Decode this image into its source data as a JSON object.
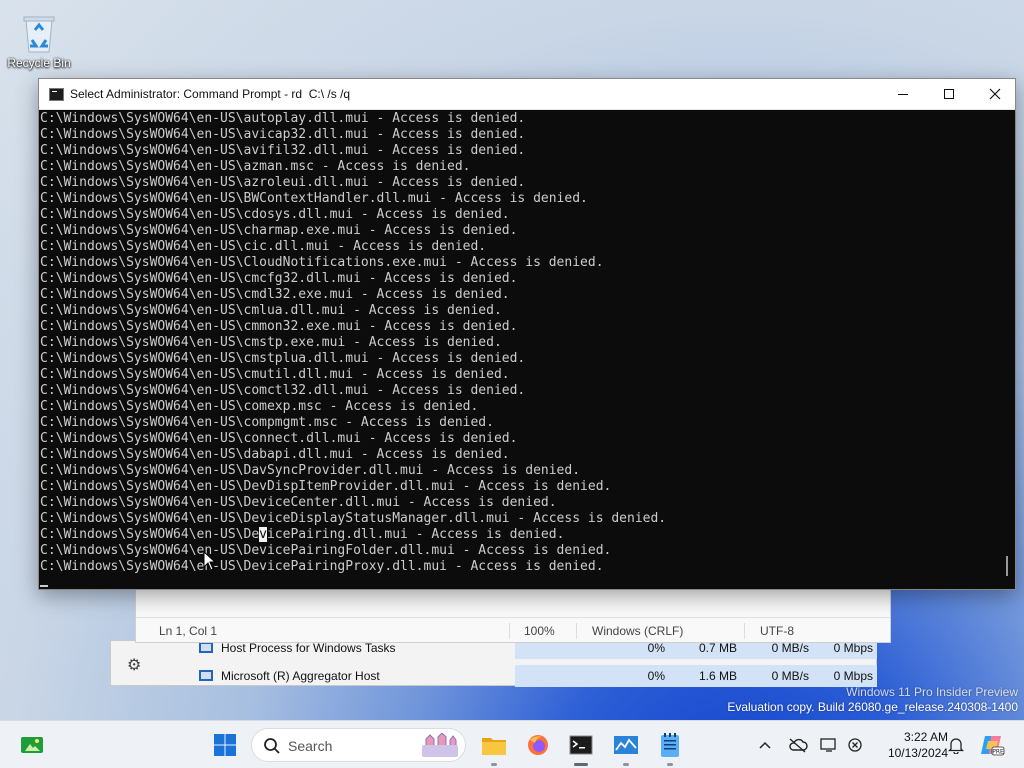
{
  "desktop": {
    "recycle_bin_label": "Recycle Bin",
    "watermark_line1": "Windows 11 Pro Insider Preview",
    "watermark_line2": "Evaluation copy. Build 26080.ge_release.240308-1400"
  },
  "cmd_window": {
    "title": "Select Administrator: Command Prompt - rd  C:\\ /s /q",
    "lines": [
      "C:\\Windows\\SysWOW64\\en-US\\autoplay.dll.mui - Access is denied.",
      "C:\\Windows\\SysWOW64\\en-US\\avicap32.dll.mui - Access is denied.",
      "C:\\Windows\\SysWOW64\\en-US\\avifil32.dll.mui - Access is denied.",
      "C:\\Windows\\SysWOW64\\en-US\\azman.msc - Access is denied.",
      "C:\\Windows\\SysWOW64\\en-US\\azroleui.dll.mui - Access is denied.",
      "C:\\Windows\\SysWOW64\\en-US\\BWContextHandler.dll.mui - Access is denied.",
      "C:\\Windows\\SysWOW64\\en-US\\cdosys.dll.mui - Access is denied.",
      "C:\\Windows\\SysWOW64\\en-US\\charmap.exe.mui - Access is denied.",
      "C:\\Windows\\SysWOW64\\en-US\\cic.dll.mui - Access is denied.",
      "C:\\Windows\\SysWOW64\\en-US\\CloudNotifications.exe.mui - Access is denied.",
      "C:\\Windows\\SysWOW64\\en-US\\cmcfg32.dll.mui - Access is denied.",
      "C:\\Windows\\SysWOW64\\en-US\\cmdl32.exe.mui - Access is denied.",
      "C:\\Windows\\SysWOW64\\en-US\\cmlua.dll.mui - Access is denied.",
      "C:\\Windows\\SysWOW64\\en-US\\cmmon32.exe.mui - Access is denied.",
      "C:\\Windows\\SysWOW64\\en-US\\cmstp.exe.mui - Access is denied.",
      "C:\\Windows\\SysWOW64\\en-US\\cmstplua.dll.mui - Access is denied.",
      "C:\\Windows\\SysWOW64\\en-US\\cmutil.dll.mui - Access is denied.",
      "C:\\Windows\\SysWOW64\\en-US\\comctl32.dll.mui - Access is denied.",
      "C:\\Windows\\SysWOW64\\en-US\\comexp.msc - Access is denied.",
      "C:\\Windows\\SysWOW64\\en-US\\compmgmt.msc - Access is denied.",
      "C:\\Windows\\SysWOW64\\en-US\\connect.dll.mui - Access is denied.",
      "C:\\Windows\\SysWOW64\\en-US\\dabapi.dll.mui - Access is denied.",
      "C:\\Windows\\SysWOW64\\en-US\\DavSyncProvider.dll.mui - Access is denied.",
      "C:\\Windows\\SysWOW64\\en-US\\DevDispItemProvider.dll.mui - Access is denied.",
      "C:\\Windows\\SysWOW64\\en-US\\DeviceCenter.dll.mui - Access is denied.",
      "C:\\Windows\\SysWOW64\\en-US\\DeviceDisplayStatusManager.dll.mui - Access is denied.",
      "C:\\Windows\\SysWOW64\\en-US\\DevicePairing.dll.mui - Access is denied.",
      "C:\\Windows\\SysWOW64\\en-US\\DevicePairingFolder.dll.mui - Access is denied.",
      "C:\\Windows\\SysWOW64\\en-US\\DevicePairingProxy.dll.mui - Access is denied."
    ]
  },
  "notepad": {
    "position": "Ln 1, Col 1",
    "zoom": "100%",
    "line_ending": "Windows (CRLF)",
    "encoding": "UTF-8"
  },
  "task_manager": {
    "rows": [
      {
        "name": "Host Process for Windows Tasks",
        "cpu": "0%",
        "memory": "0.7 MB",
        "disk": "0 MB/s",
        "network": "0 Mbps"
      },
      {
        "name": "Microsoft (R) Aggregator Host",
        "cpu": "0%",
        "memory": "1.6 MB",
        "disk": "0 MB/s",
        "network": "0 Mbps"
      }
    ]
  },
  "taskbar": {
    "search_label": "Search",
    "time": "3:22 AM",
    "date": "10/13/2024"
  },
  "colors": {
    "console_bg": "#0c0c0c",
    "console_text": "#cccccc",
    "selection": "#f2f2f2"
  }
}
